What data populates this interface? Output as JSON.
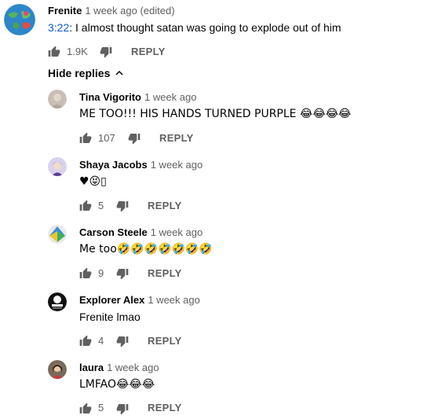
{
  "main_comment": {
    "author": "Frenite",
    "time": "1 week ago (edited)",
    "timestamp_link": "3:22",
    "text": ": I almost thought satan was going to explode out of him",
    "likes": "1.9K",
    "reply_label": "REPLY"
  },
  "hide_replies_label": "Hide replies",
  "replies": [
    {
      "author": "Tina Vigorito",
      "time": "1 week ago",
      "text": "ME TOO!!! HIS HANDS TURNED PURPLE 😂😂😂😂",
      "likes": "107",
      "reply_label": "REPLY"
    },
    {
      "author": "Shaya Jacobs",
      "time": "1 week ago",
      "text": "♥😝▯",
      "likes": "5",
      "reply_label": "REPLY"
    },
    {
      "author": "Carson Steele",
      "time": "1 week ago",
      "text": "Me too🤣🤣🤣🤣🤣🤣🤣",
      "likes": "9",
      "reply_label": "REPLY"
    },
    {
      "author": "Explorer Alex",
      "time": "1 week ago",
      "text": "Frenite lmao",
      "likes": "4",
      "reply_label": "REPLY"
    },
    {
      "author": "laura",
      "time": "1 week ago",
      "text": "LMFAO😂😂😂",
      "likes": "5",
      "reply_label": "REPLY"
    }
  ],
  "icons": {
    "like": "thumbs-up-icon",
    "dislike": "thumbs-down-icon",
    "chevron": "chevron-up-icon"
  },
  "colors": {
    "timestamp_link": "#065fd4",
    "secondary_text": "#606060"
  }
}
